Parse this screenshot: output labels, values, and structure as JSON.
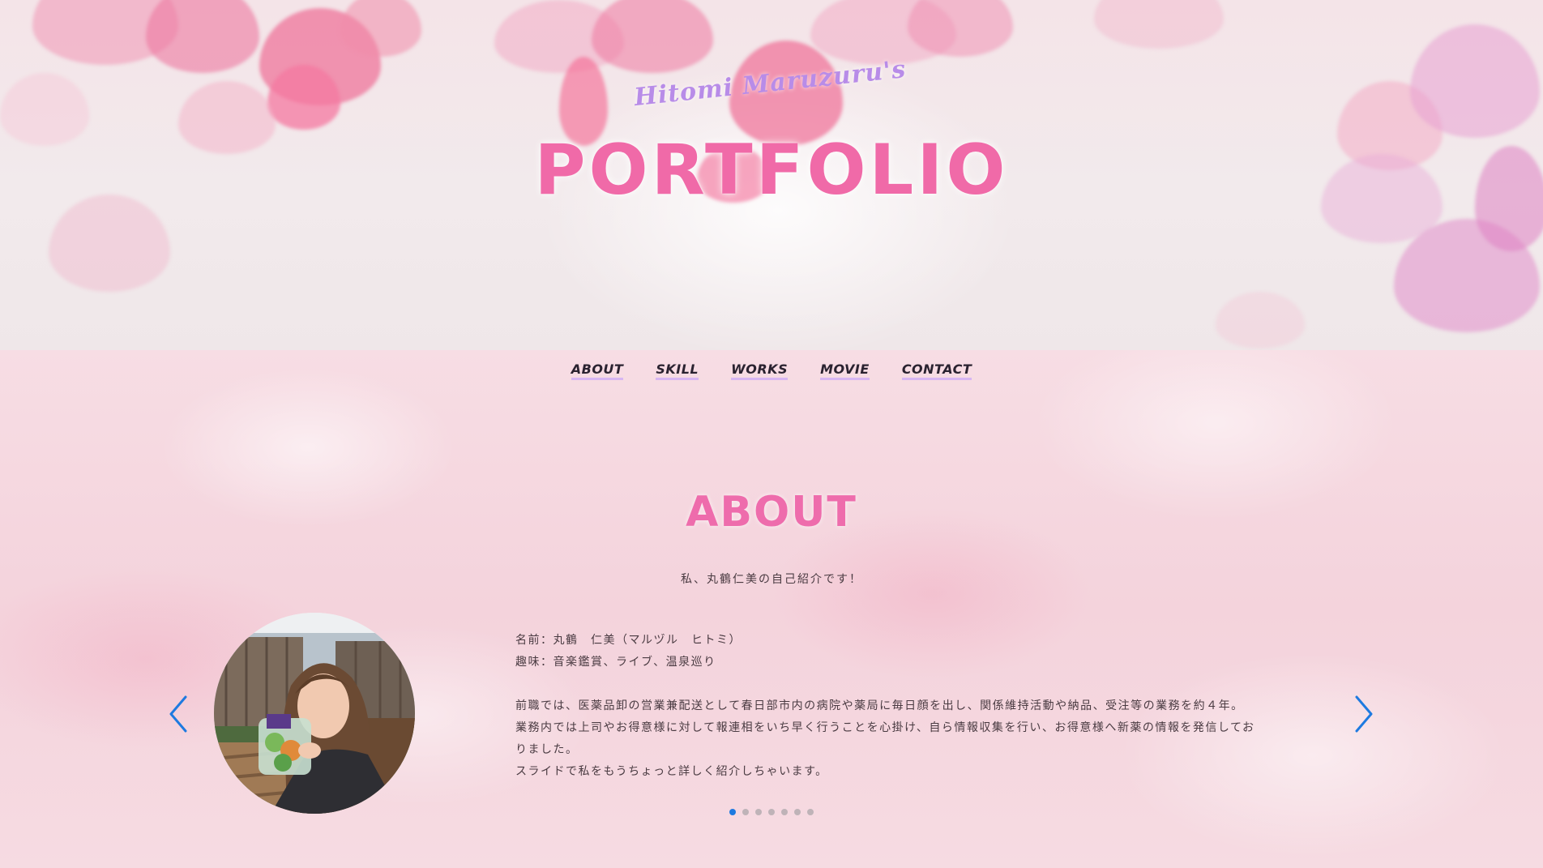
{
  "hero": {
    "subtitle": "Hitomi Maruzuru's",
    "title": "PORTFOLIO"
  },
  "nav": {
    "items": [
      {
        "label": "ABOUT"
      },
      {
        "label": "SKILL"
      },
      {
        "label": "WORKS"
      },
      {
        "label": "MOVIE"
      },
      {
        "label": "CONTACT"
      }
    ]
  },
  "about": {
    "heading": "ABOUT",
    "lead": "私、丸鶴仁美の自己紹介です！",
    "slide": {
      "line1": "名前：丸鶴　仁美（マルヅル　ヒトミ）",
      "line2": "趣味：音楽鑑賞、ライブ、温泉巡り",
      "line3": "前職では、医薬品卸の営業兼配送として春日部市内の病院や薬局に毎日顔を出し、関係維持活動や納品、受注等の業務を約４年。",
      "line4": "業務内では上司やお得意様に対して報連相をいち早く行うことを心掛け、自ら情報収集を行い、お得意様へ新薬の情報を発信してお",
      "line5": "りました。",
      "line6": "スライドで私をもうちょっと詳しく紹介しちゃいます。"
    },
    "pagination": {
      "total": 7,
      "active": 1
    }
  },
  "colors": {
    "accent_pink": "#ee6cac",
    "subtitle_purple": "#b88ce8",
    "nav_underline": "#d7b6f2",
    "active_dot": "#1e7ae0",
    "arrow": "#1e7ae0"
  },
  "icons": {
    "prev": "chevron-left-icon",
    "next": "chevron-right-icon"
  }
}
